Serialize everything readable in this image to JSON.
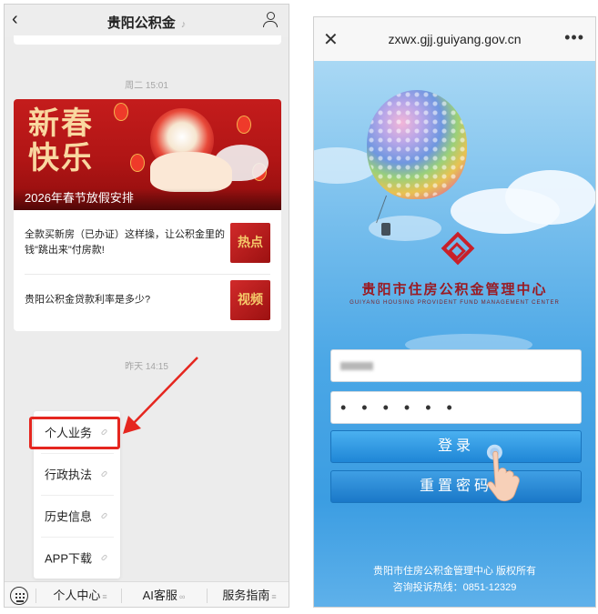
{
  "left": {
    "header": {
      "title": "贵阳公积金",
      "mute_icon": "bell-mute-icon",
      "user_icon": "user-icon"
    },
    "timestamps": [
      "周二 15:01",
      "昨天 14:15"
    ],
    "card": {
      "banner_calligraphy": "新春快乐",
      "banner_caption": "2026年春节放假安排",
      "articles": [
        {
          "text": "全款买新房（已办证）这样操，让公积金里的钱\"跳出来\"付房款!",
          "thumb": "热点"
        },
        {
          "text": "贵阳公积金贷款利率是多少?",
          "thumb": "视频"
        }
      ]
    },
    "menu": {
      "items": [
        "个人业务",
        "行政执法",
        "历史信息",
        "APP下载"
      ]
    },
    "bottom_tabs": [
      "个人中心",
      "AI客服",
      "服务指南"
    ],
    "accent": "#e5261f"
  },
  "right": {
    "header": {
      "url": "zxwx.gjj.guiyang.gov.cn"
    },
    "org_name_cn": "贵阳市住房公积金管理中心",
    "org_name_en": "GUIYANG HOUSING PROVIDENT FUND MANAGEMENT CENTER",
    "password_mask": "• • • • • •",
    "login_label": "登录",
    "reset_label": "重置密码",
    "footer_line1": "贵阳市住房公积金管理中心 版权所有",
    "footer_line2": "咨询投诉热线：0851-12329",
    "brand_color": "#c8202a",
    "button_color": "#2b8fdc"
  }
}
